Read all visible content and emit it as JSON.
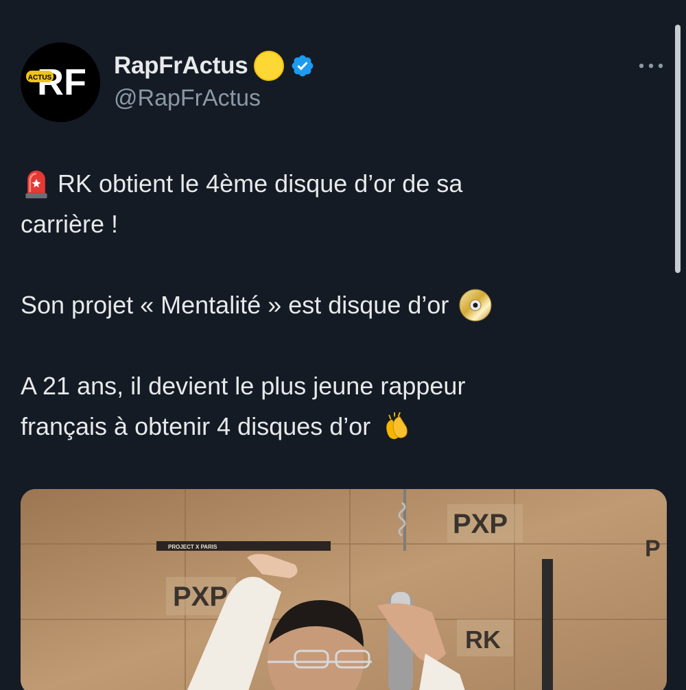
{
  "header": {
    "display_name": "RapFrActus",
    "handle": "@RapFrActus",
    "avatar_text_main": "RF",
    "avatar_text_badge": "ACTUS",
    "more_icon": "more-horizontal-icon",
    "verified_icon": "verified-badge-icon",
    "status_emoji": "yellow-circle-emoji"
  },
  "tweet": {
    "line1": "RK obtient le 4ème disque d’or de sa",
    "line2": "carrière !",
    "line3": "Son projet « Mentalité » est disque d’or",
    "line4": "A 21 ans, il devient le plus jeune rappeur",
    "line5": "français à obtenir 4 disques d’or",
    "emojis": [
      "siren-emoji",
      "dvd-emoji",
      "clapping-hands-emoji"
    ]
  },
  "media": {
    "wall_labels": [
      "PXP",
      "PXP",
      "RK",
      "P"
    ],
    "banner_text": "PROJECT X PARIS",
    "description_icon": "photo-studio-microphone"
  },
  "colors": {
    "background": "#141b25",
    "text": "#e7e9ea",
    "secondary_text": "#8b98a5",
    "verified_blue": "#1d9bf0"
  }
}
